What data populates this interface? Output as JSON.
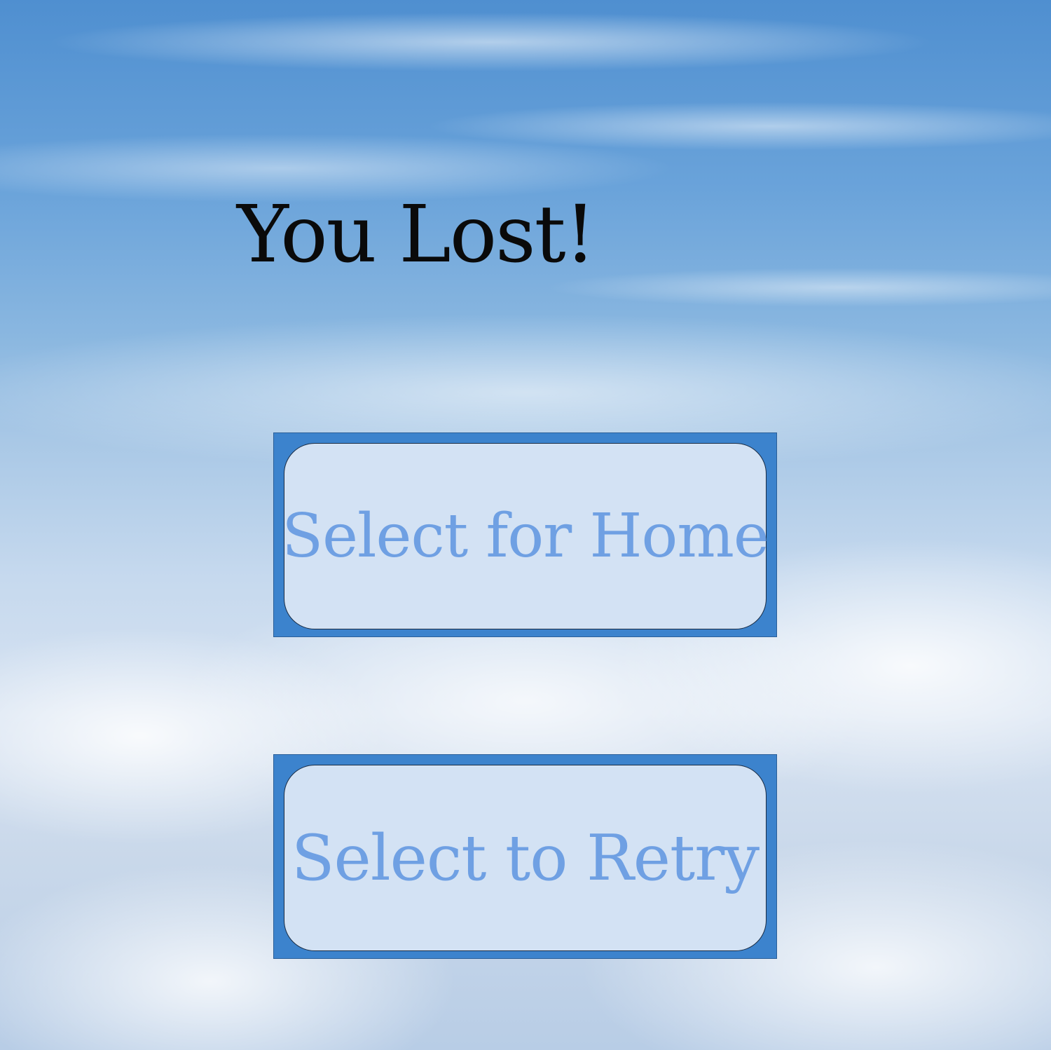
{
  "screen": {
    "title": "You Lost!",
    "background": "sky-clouds"
  },
  "buttons": {
    "home_label": "Select for Home",
    "retry_label": "Select to Retry"
  },
  "colors": {
    "button_frame": "#3c83cd",
    "button_fill": "#d3e2f4",
    "button_text": "#6fa0e3",
    "title_text": "#0a0a0a"
  }
}
